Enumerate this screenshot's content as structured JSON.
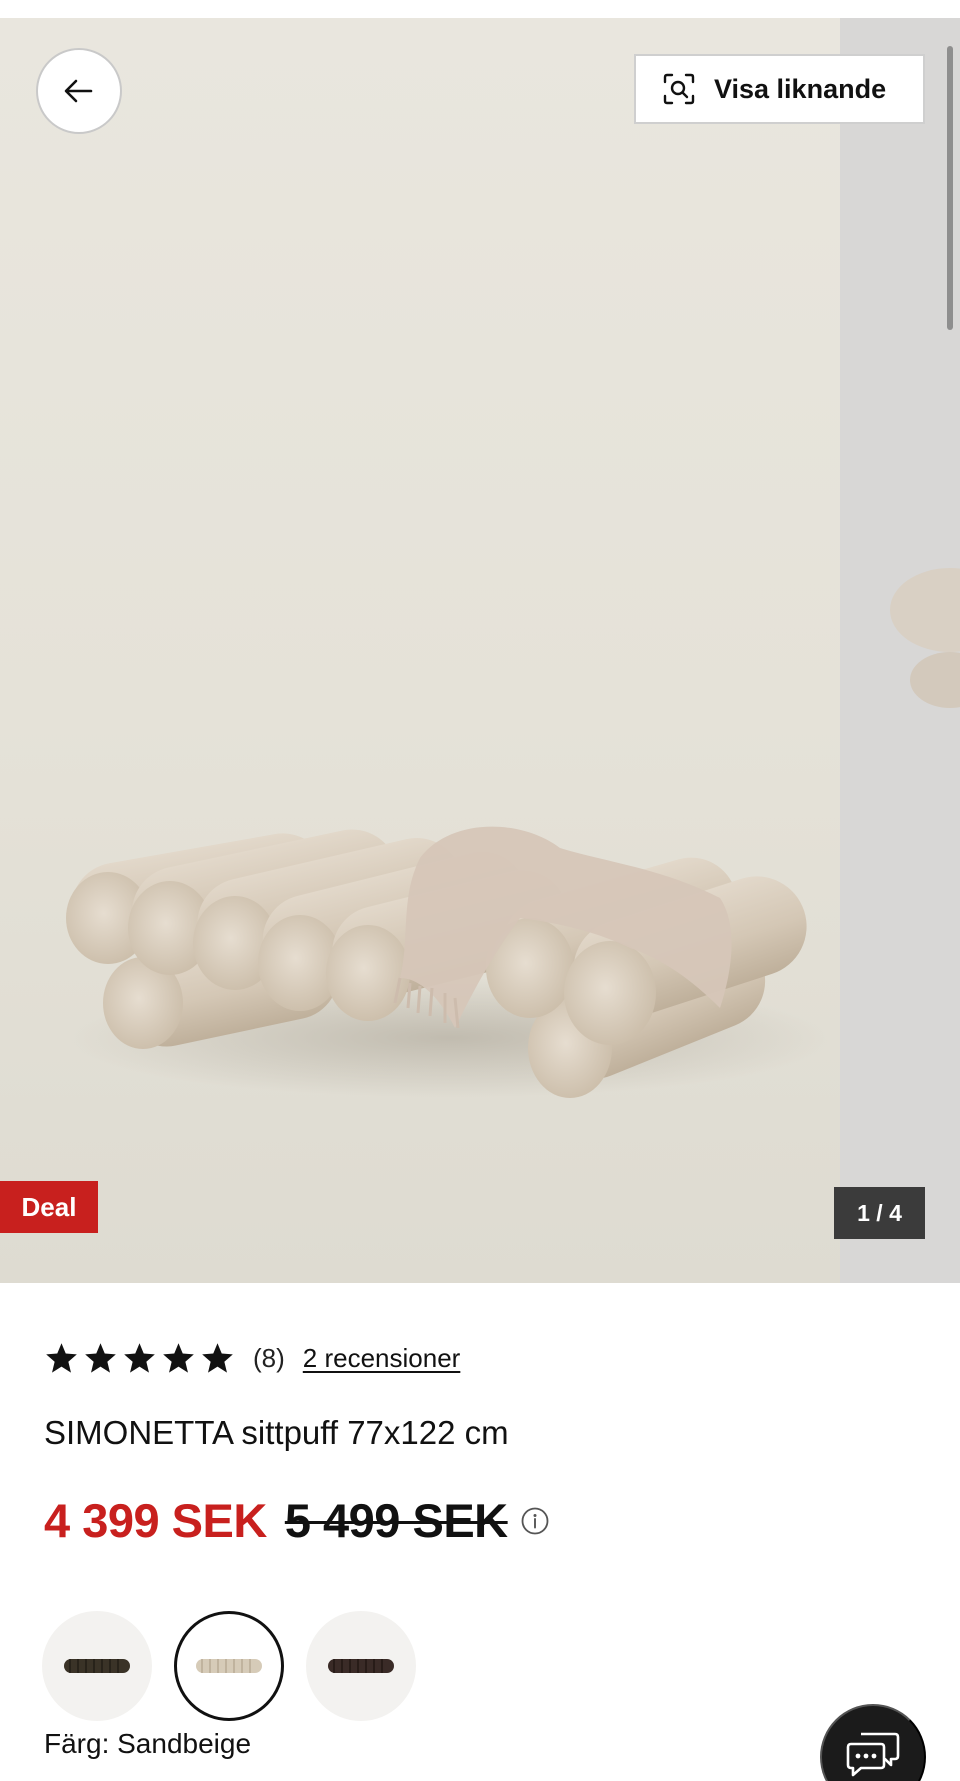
{
  "gallery": {
    "back_icon": "arrow-left-icon",
    "visa_liknande_label": "Visa liknande",
    "visa_liknande_icon": "visual-search-icon",
    "deal_badge": "Deal",
    "counter": "1 / 4"
  },
  "product": {
    "rating": 5,
    "rating_count": "(8)",
    "reviews_link": "2 recensioner",
    "title": "SIMONETTA sittpuff 77x122 cm",
    "price_now": "4 399 SEK",
    "price_old": "5 499 SEK",
    "info_icon": "info-icon",
    "color_label": "Färg: Sandbeige",
    "swatches": [
      {
        "name": "dark-olive",
        "color": "#3a3327",
        "selected": false
      },
      {
        "name": "sandbeige",
        "color": "#d6cbb8",
        "selected": true
      },
      {
        "name": "dark-brown",
        "color": "#3a2b27",
        "selected": false
      }
    ]
  },
  "colors": {
    "accent_red": "#c8201e",
    "text": "#111111"
  },
  "chat_icon": "chat-bubbles-icon"
}
